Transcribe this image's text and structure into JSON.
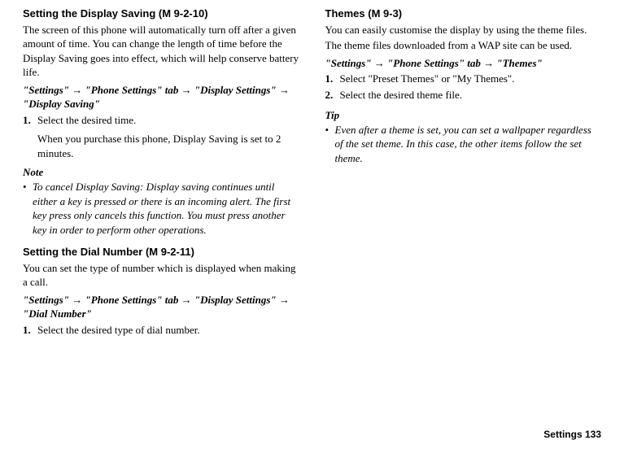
{
  "left": {
    "sec1": {
      "title": "Setting the Display Saving",
      "code": " (M 9-2-10)",
      "body": "The screen of this phone will automatically turn off after a given amount of time. You can change the length of time before the Display Saving goes into effect, which will help conserve battery life.",
      "path": "\"Settings\" → \"Phone Settings\" tab → \"Display Settings\" → \"Display Saving\"",
      "step1_num": "1.",
      "step1_text": "Select the desired time.",
      "step1_follow": "When you purchase this phone, Display Saving is set to 2 minutes.",
      "note_label": "Note",
      "note_bullet": "•",
      "note_text": "To cancel Display Saving: Display saving continues until either a key is pressed or there is an incoming alert. The first key press only cancels this function. You must press another key in order to perform other operations."
    },
    "sec2": {
      "title": "Setting the Dial Number",
      "code": " (M 9-2-11)",
      "body": "You can set the type of number which is displayed when making a call.",
      "path": "\"Settings\" → \"Phone Settings\" tab → \"Display Settings\" → \"Dial Number\"",
      "step1_num": "1.",
      "step1_text": "Select the desired type of dial number."
    }
  },
  "right": {
    "sec1": {
      "title": "Themes",
      "code": " (M 9-3)",
      "body1": "You can easily customise the display by using the theme files.",
      "body2": "The theme files downloaded from a WAP site can be used.",
      "path": "\"Settings\" → \"Phone Settings\" tab → \"Themes\"",
      "step1_num": "1.",
      "step1_text": "Select \"Preset Themes\" or \"My Themes\".",
      "step2_num": "2.",
      "step2_text": "Select the desired theme file.",
      "tip_label": "Tip",
      "tip_bullet": "•",
      "tip_text": "Even after a theme is set, you can set a wallpaper regardless of the set theme. In this case, the other items follow the set theme."
    }
  },
  "footer": {
    "text": "Settings   133"
  }
}
